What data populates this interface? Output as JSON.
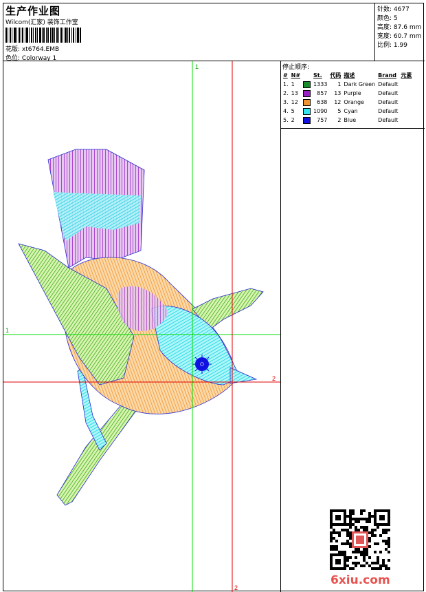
{
  "header": {
    "title": "生产作业图",
    "company": "Wilcom(汇家) 装饰工作室",
    "design_label": "花版:",
    "design_value": "xt6764.EMB",
    "colorway_label": "色位:",
    "colorway_value": "Colorway 1"
  },
  "stats": {
    "stitches_label": "针数:",
    "stitches_value": "4677",
    "colors_label": "颜色:",
    "colors_value": "5",
    "height_label": "高度:",
    "height_value": "87.6 mm",
    "width_label": "宽度:",
    "width_value": "60.7 mm",
    "scale_label": "比例:",
    "scale_value": "1.99"
  },
  "stop_sequence": {
    "caption": "停止顺序:",
    "headers": [
      "#",
      "N#",
      "St.",
      "代码",
      "描述",
      "Brand",
      "元素"
    ],
    "rows": [
      {
        "idx": "1.",
        "n": "1",
        "st": "1333",
        "code": "1",
        "desc": "Dark Green",
        "brand": "Default",
        "color": "#1a8c2a"
      },
      {
        "idx": "2.",
        "n": "13",
        "st": "857",
        "code": "13",
        "desc": "Purple",
        "brand": "Default",
        "color": "#9a1fc4"
      },
      {
        "idx": "3.",
        "n": "12",
        "st": "638",
        "code": "12",
        "desc": "Orange",
        "brand": "Default",
        "color": "#f0922e"
      },
      {
        "idx": "4.",
        "n": "5",
        "st": "1090",
        "code": "5",
        "desc": "Cyan",
        "brand": "Default",
        "color": "#2fe6f0"
      },
      {
        "idx": "5.",
        "n": "2",
        "st": "757",
        "code": "2",
        "desc": "Blue",
        "brand": "Default",
        "color": "#1010e0"
      }
    ]
  },
  "guides": {
    "v1_label": "1",
    "h1_label": "1",
    "v2_label": "2",
    "h2_label": "2",
    "green": "#00dd00",
    "red": "#e00000"
  },
  "watermark": "6xiu.com"
}
